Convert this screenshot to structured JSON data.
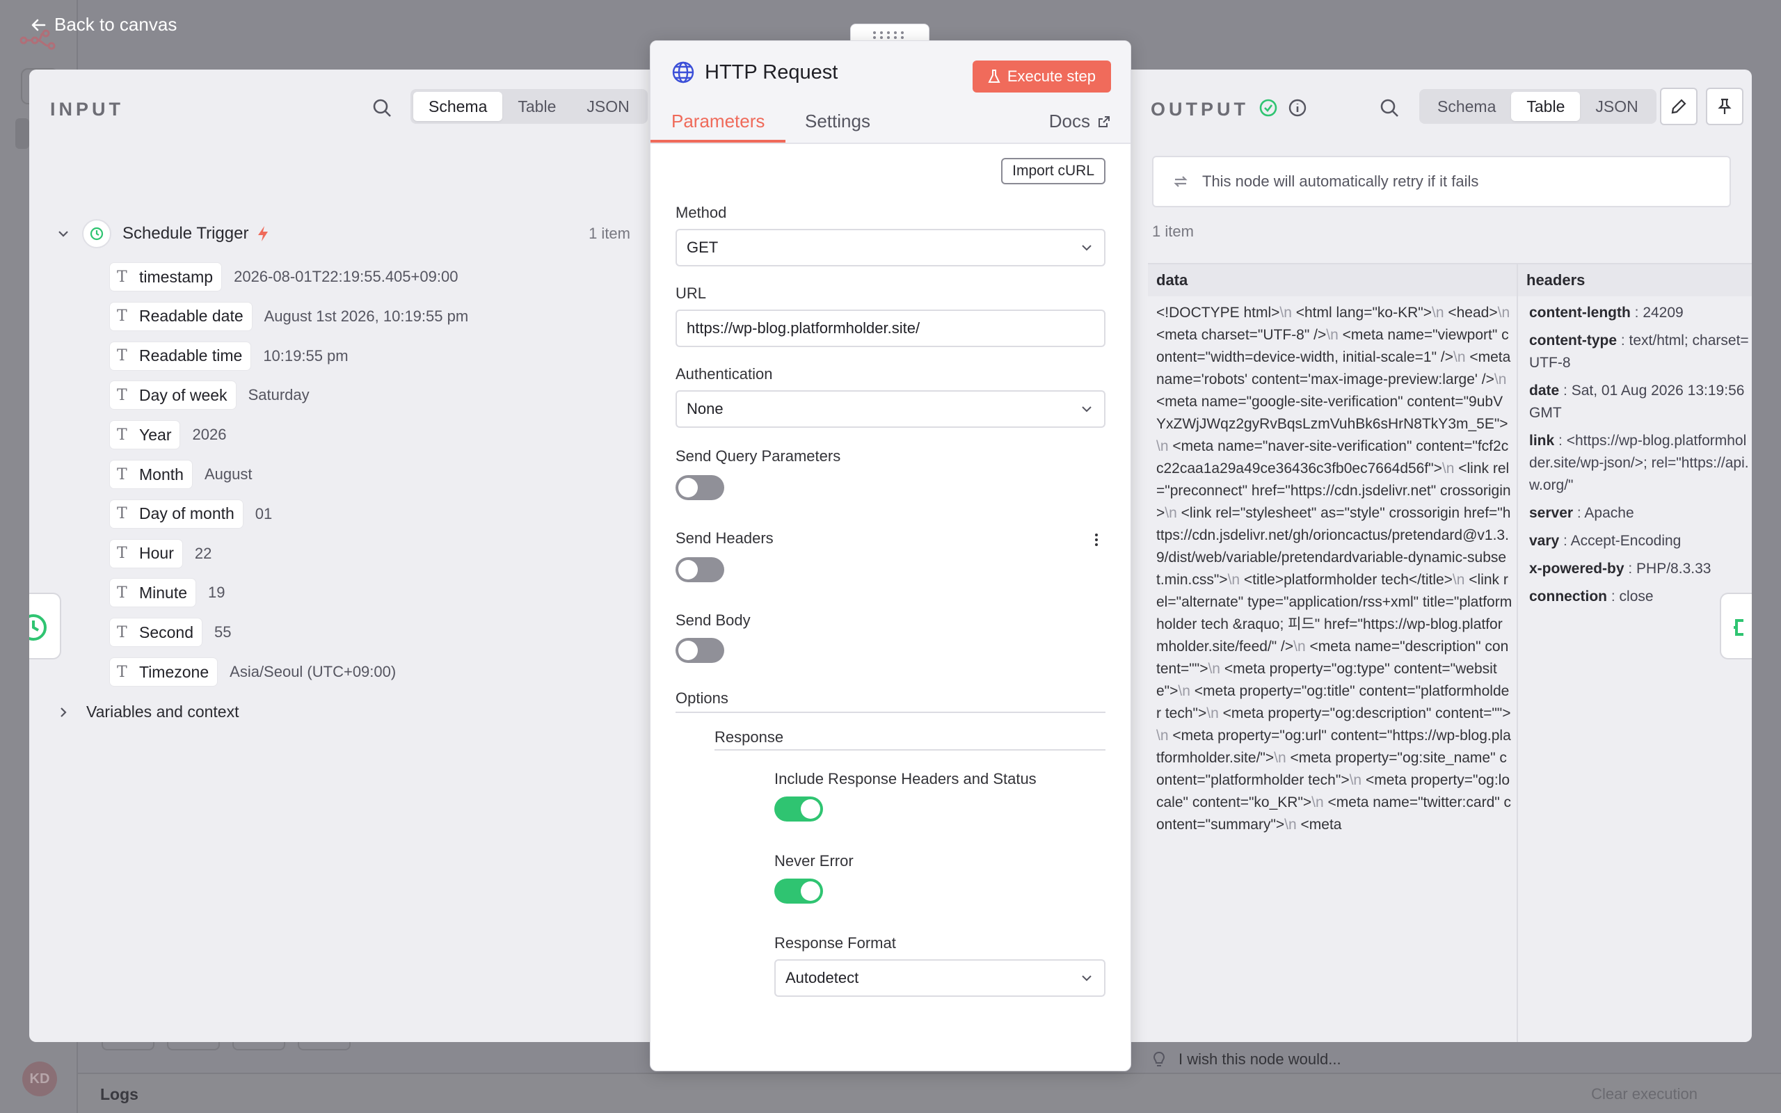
{
  "back": {
    "label": "Back to canvas"
  },
  "canvas": {
    "logs_label": "Logs",
    "clear_execution": "Clear execution",
    "avatar": "KD"
  },
  "input": {
    "title": "INPUT",
    "views": [
      "Schema",
      "Table",
      "JSON"
    ],
    "active_view": "Schema",
    "trigger_name": "Schedule Trigger",
    "item_count": "1 item",
    "fields": [
      {
        "name": "timestamp",
        "value": "2026-08-01T22:19:55.405+09:00"
      },
      {
        "name": "Readable date",
        "value": "August 1st 2026, 10:19:55 pm"
      },
      {
        "name": "Readable time",
        "value": "10:19:55 pm"
      },
      {
        "name": "Day of week",
        "value": "Saturday"
      },
      {
        "name": "Year",
        "value": "2026"
      },
      {
        "name": "Month",
        "value": "August"
      },
      {
        "name": "Day of month",
        "value": "01"
      },
      {
        "name": "Hour",
        "value": "22"
      },
      {
        "name": "Minute",
        "value": "19"
      },
      {
        "name": "Second",
        "value": "55"
      },
      {
        "name": "Timezone",
        "value": "Asia/Seoul (UTC+09:00)"
      }
    ],
    "variables_label": "Variables and context"
  },
  "node": {
    "title": "HTTP Request",
    "execute_label": "Execute step",
    "tabs": [
      "Parameters",
      "Settings"
    ],
    "docs_label": "Docs",
    "import_curl": "Import cURL",
    "method_label": "Method",
    "method_value": "GET",
    "url_label": "URL",
    "url_value": "https://wp-blog.platformholder.site/",
    "auth_label": "Authentication",
    "auth_value": "None",
    "send_query_label": "Send Query Parameters",
    "send_query_on": false,
    "send_headers_label": "Send Headers",
    "send_headers_on": false,
    "send_body_label": "Send Body",
    "send_body_on": false,
    "options_label": "Options",
    "response_label": "Response",
    "include_headers_label": "Include Response Headers and Status",
    "include_headers_on": true,
    "never_error_label": "Never Error",
    "never_error_on": true,
    "response_format_label": "Response Format",
    "response_format_value": "Autodetect"
  },
  "output": {
    "title": "OUTPUT",
    "views": [
      "Schema",
      "Table",
      "JSON"
    ],
    "active_view": "Table",
    "retry_notice": "This node will automatically retry if it fails",
    "item_count": "1 item",
    "columns": [
      "data",
      "headers"
    ],
    "data_lines": [
      "<!DOCTYPE html>\\n <html lang=\"ko-KR\">\\n <head>\\n     <meta charset=\"UTF-8\" />\\n     <meta name=\"viewport\" content=\"width=device-width, initial-scale=1\" />\\n <meta name='robots' content='max-image-preview:large' />\\n <meta name=\"google-site-verification\" content=\"9ubVYxZWjJWqz2gyRvBqsLzmVuhBk6sHrN8TkY3m_5E\">\\n <meta name=\"naver-site-verification\" content=\"fcf2cc22caa1a29a49ce36436c3fb0ec7664d56f\">\\n <link rel=\"preconnect\" href=\"https://cdn.jsdelivr.net\" crossorigin>\\n <link rel=\"stylesheet\" as=\"style\" crossorigin href=\"https://cdn.jsdelivr.net/gh/orioncactus/pretendard@v1.3.9/dist/web/variable/pretendardvariable-dynamic-subset.min.css\">\\n <title>platformholder tech</title>\\n <link rel=\"alternate\" type=\"application/rss+xml\" title=\"platformholder tech &raquo; 피드\" href=\"https://wp-blog.platformholder.site/feed/\" />\\n <meta name=\"description\" content=\"\">\\n <meta property=\"og:type\" content=\"website\">\\n <meta property=\"og:title\" content=\"platformholder tech\">\\n <meta property=\"og:description\" content=\"\">\\n <meta property=\"og:url\" content=\"https://wp-blog.platformholder.site/\">\\n <meta property=\"og:site_name\" content=\"platformholder tech\">\\n <meta property=\"og:locale\" content=\"ko_KR\">\\n <meta name=\"twitter:card\" content=\"summary\">\\n <meta"
    ],
    "headers": [
      {
        "key": "content-length",
        "value": "24209"
      },
      {
        "key": "content-type",
        "value": "text/html; charset=UTF-8"
      },
      {
        "key": "date",
        "value": "Sat, 01 Aug 2026 13:19:56 GMT"
      },
      {
        "key": "link",
        "value": "<https://wp-blog.platformholder.site/wp-json/>; rel=\"https://api.w.org/\""
      },
      {
        "key": "server",
        "value": "Apache"
      },
      {
        "key": "vary",
        "value": "Accept-Encoding"
      },
      {
        "key": "x-powered-by",
        "value": "PHP/8.3.33"
      },
      {
        "key": "connection",
        "value": "close"
      }
    ],
    "wish_label": "I wish this node would..."
  },
  "colors": {
    "accent": "#ef6a5a",
    "toggle_on": "#2fc471",
    "success": "#2fc471"
  }
}
